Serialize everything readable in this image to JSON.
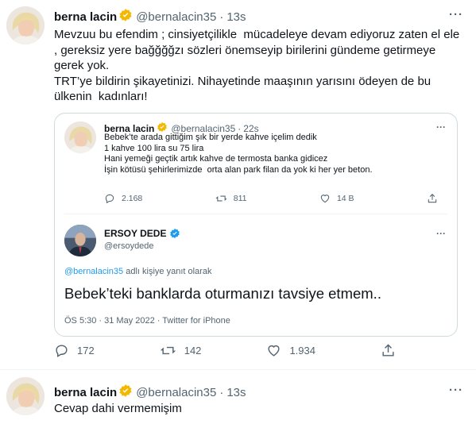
{
  "tweet1": {
    "name": "berna lacin",
    "handle": "@bernalacin35",
    "time": "13s",
    "more": "···",
    "text": "Mevzuu bu efendim ; cinsiyetçilikle  mücadeleye devam ediyoruz zaten el ele\n, gereksiz yere bağğğğzı sözleri önemseyip birilerini gündeme getirmeye\ngerek yok.\nTRT’ye bildirin şikayetinizi. Nihayetinde maaşının yarısını ödeyen de bu\nülkenin  kadınları!",
    "actions": {
      "reply_count": "172",
      "retweet_count": "142",
      "like_count": "1.934"
    },
    "quoted": {
      "tweet": {
        "name": "berna lacin",
        "handle": "@bernalacin35",
        "time": "22s",
        "text": "Bebek’te arada gittiğim şık bir yerde kahve içelim dedik\n1 kahve 100 lira su 75 lira\nHani yemeği geçtik artık kahve de termosta banka gidicez\nİşin kötüsü şehirlerimizde  orta alan park filan da yok ki her yer beton.",
        "reply_count": "2.168",
        "retweet_count": "811",
        "like_count": "14 B"
      },
      "reply": {
        "name": "ERSOY DEDE",
        "handle": "@ersoydede",
        "replying_mention": "@bernalacin35",
        "replying_suffix": " adlı kişiye yanıt olarak",
        "text": "Bebek’teki banklarda oturmanızı tavsiye etmem..",
        "meta": "ÖS 5:30 · 31 May 2022 · Twitter for iPhone"
      }
    }
  },
  "tweet2": {
    "name": "berna lacin",
    "handle": "@bernalacin35",
    "time": "13s",
    "more": "···",
    "text": "Cevap dahi vermemişim"
  },
  "colors": {
    "accent": "#1d9bf0",
    "gold_badge": "#f5b800",
    "muted": "#536471"
  },
  "icons": [
    "avatar",
    "gold-badge-icon",
    "verified-badge-icon",
    "reply-icon",
    "retweet-icon",
    "like-icon",
    "share-icon",
    "more-icon"
  ]
}
